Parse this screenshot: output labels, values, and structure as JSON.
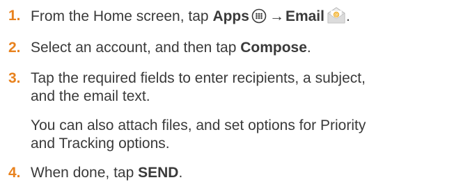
{
  "steps": [
    {
      "number": "1.",
      "parts": {
        "a": "From the Home screen, tap ",
        "b": "Apps",
        "arrow": "→",
        "c": "Email",
        "end": "."
      }
    },
    {
      "number": "2.",
      "parts": {
        "a": "Select an account, and then tap ",
        "b": "Compose",
        "end": "."
      }
    },
    {
      "number": "3.",
      "line1": "Tap the required fields to enter recipients, a subject,",
      "line2": "and the email text."
    },
    {
      "number": "4.",
      "parts": {
        "a": "When done, tap ",
        "b": "SEND",
        "end": "."
      }
    }
  ],
  "note": {
    "line1": "You can also attach files, and set options for Priority",
    "line2": "and Tracking options."
  },
  "icons": {
    "apps": "apps-grid-icon",
    "email": "email-envelope-icon"
  },
  "colors": {
    "number": "#e8821e",
    "text": "#3a3a3a"
  }
}
